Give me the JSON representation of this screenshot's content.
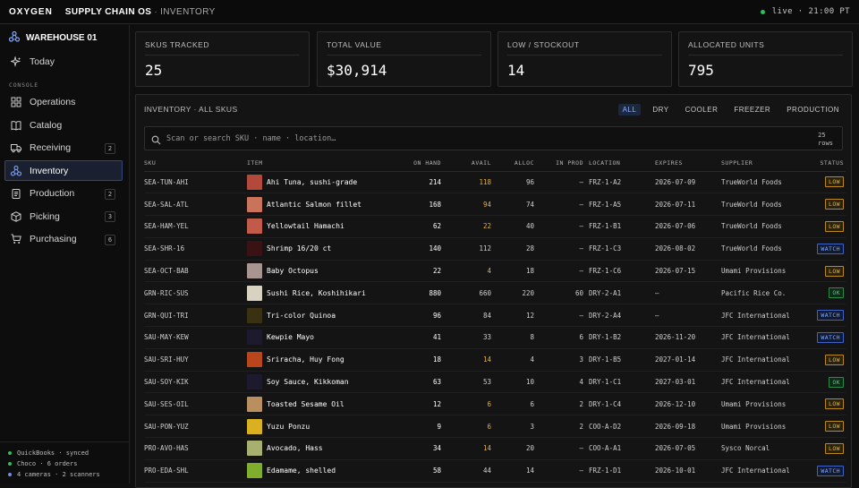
{
  "topbar": {
    "brand": "OXYGEN",
    "app": "SUPPLY CHAIN OS",
    "separator": "·",
    "section": "INVENTORY",
    "live_text": "live · 21:00 PT"
  },
  "sidebar": {
    "warehouse": "WAREHOUSE 01",
    "today_label": "Today",
    "section_label": "CONSOLE",
    "items": [
      {
        "label": "Operations",
        "icon": "operations-icon",
        "badge": ""
      },
      {
        "label": "Catalog",
        "icon": "book-icon",
        "badge": ""
      },
      {
        "label": "Receiving",
        "icon": "truck-icon",
        "badge": "2"
      },
      {
        "label": "Inventory",
        "icon": "network-icon",
        "badge": "",
        "active": true
      },
      {
        "label": "Production",
        "icon": "clipboard-icon",
        "badge": "2"
      },
      {
        "label": "Picking",
        "icon": "box-icon",
        "badge": "3"
      },
      {
        "label": "Purchasing",
        "icon": "cart-icon",
        "badge": "6"
      }
    ],
    "sync": [
      {
        "text": "QuickBooks · synced",
        "color": "#2fbf58"
      },
      {
        "text": "Choco · 6 orders",
        "color": "#2fbf58"
      },
      {
        "text": "4 cameras · 2 scanners",
        "color": "#6f8fe6"
      }
    ]
  },
  "kpis": [
    {
      "label": "SKUS TRACKED",
      "value": "25"
    },
    {
      "label": "TOTAL VALUE",
      "value": "$30,914"
    },
    {
      "label": "LOW / STOCKOUT",
      "value": "14"
    },
    {
      "label": "ALLOCATED UNITS",
      "value": "795"
    }
  ],
  "inventory": {
    "title": "INVENTORY · ALL SKUS",
    "filters": [
      "ALL",
      "DRY",
      "COOLER",
      "FREEZER",
      "PRODUCTION"
    ],
    "active_filter": "ALL",
    "search_placeholder": "Scan or search SKU · name · location…",
    "rows_count": "25",
    "rows_label": "rows",
    "columns": [
      "SKU",
      "ITEM",
      "ON HAND",
      "AVAIL",
      "ALLOC",
      "IN PROD",
      "LOCATION",
      "EXPIRES",
      "SUPPLIER",
      "STATUS"
    ],
    "rows": [
      {
        "sku": "SEA-TUN-AHI",
        "item": "Ahi Tuna, sushi-grade",
        "on_hand": "214",
        "avail": "118",
        "alloc": "96",
        "in_prod": "—",
        "location": "FRZ-1-A2",
        "expires": "2026-07-09",
        "supplier": "TrueWorld Foods",
        "status": "LOW",
        "thumb": "#b2493a"
      },
      {
        "sku": "SEA-SAL-ATL",
        "item": "Atlantic Salmon fillet",
        "on_hand": "168",
        "avail": "94",
        "alloc": "74",
        "in_prod": "—",
        "location": "FRZ-1-A5",
        "expires": "2026-07-11",
        "supplier": "TrueWorld Foods",
        "status": "LOW",
        "thumb": "#c9745a"
      },
      {
        "sku": "SEA-HAM-YEL",
        "item": "Yellowtail Hamachi",
        "on_hand": "62",
        "avail": "22",
        "alloc": "40",
        "in_prod": "—",
        "location": "FRZ-1-B1",
        "expires": "2026-07-06",
        "supplier": "TrueWorld Foods",
        "status": "LOW",
        "thumb": "#c25a4a"
      },
      {
        "sku": "SEA-SHR-16",
        "item": "Shrimp 16/20 ct",
        "on_hand": "140",
        "avail": "112",
        "alloc": "28",
        "in_prod": "—",
        "location": "FRZ-1-C3",
        "expires": "2026-08-02",
        "supplier": "TrueWorld Foods",
        "status": "WATCH",
        "thumb": "#3a1214"
      },
      {
        "sku": "SEA-OCT-BAB",
        "item": "Baby Octopus",
        "on_hand": "22",
        "avail": "4",
        "alloc": "18",
        "in_prod": "—",
        "location": "FRZ-1-C6",
        "expires": "2026-07-15",
        "supplier": "Umami Provisions",
        "status": "LOW",
        "thumb": "#a89590"
      },
      {
        "sku": "GRN-RIC-SUS",
        "item": "Sushi Rice, Koshihikari",
        "on_hand": "880",
        "avail": "660",
        "alloc": "220",
        "in_prod": "60",
        "location": "DRY-2-A1",
        "expires": "—",
        "supplier": "Pacific Rice Co.",
        "status": "OK",
        "thumb": "#d8d2c0"
      },
      {
        "sku": "GRN-QUI-TRI",
        "item": "Tri-color Quinoa",
        "on_hand": "96",
        "avail": "84",
        "alloc": "12",
        "in_prod": "—",
        "location": "DRY-2-A4",
        "expires": "—",
        "supplier": "JFC International",
        "status": "WATCH",
        "thumb": "#3a3012"
      },
      {
        "sku": "SAU-MAY-KEW",
        "item": "Kewpie Mayo",
        "on_hand": "41",
        "avail": "33",
        "alloc": "8",
        "in_prod": "6",
        "location": "DRY-1-B2",
        "expires": "2026-11-20",
        "supplier": "JFC International",
        "status": "WATCH",
        "thumb": "#1e1a2e"
      },
      {
        "sku": "SAU-SRI-HUY",
        "item": "Sriracha, Huy Fong",
        "on_hand": "18",
        "avail": "14",
        "alloc": "4",
        "in_prod": "3",
        "location": "DRY-1-B5",
        "expires": "2027-01-14",
        "supplier": "JFC International",
        "status": "LOW",
        "thumb": "#b8451c"
      },
      {
        "sku": "SAU-SOY-KIK",
        "item": "Soy Sauce, Kikkoman",
        "on_hand": "63",
        "avail": "53",
        "alloc": "10",
        "in_prod": "4",
        "location": "DRY-1-C1",
        "expires": "2027-03-01",
        "supplier": "JFC International",
        "status": "OK",
        "thumb": "#1e1a2e"
      },
      {
        "sku": "SAU-SES-OIL",
        "item": "Toasted Sesame Oil",
        "on_hand": "12",
        "avail": "6",
        "alloc": "6",
        "in_prod": "2",
        "location": "DRY-1-C4",
        "expires": "2026-12-10",
        "supplier": "Umami Provisions",
        "status": "LOW",
        "thumb": "#b89060"
      },
      {
        "sku": "SAU-PON-YUZ",
        "item": "Yuzu Ponzu",
        "on_hand": "9",
        "avail": "6",
        "alloc": "3",
        "in_prod": "2",
        "location": "COO-A-D2",
        "expires": "2026-09-18",
        "supplier": "Umami Provisions",
        "status": "LOW",
        "thumb": "#d9b020"
      },
      {
        "sku": "PRO-AVO-HAS",
        "item": "Avocado, Hass",
        "on_hand": "34",
        "avail": "14",
        "alloc": "20",
        "in_prod": "—",
        "location": "COO-A-A1",
        "expires": "2026-07-05",
        "supplier": "Sysco Norcal",
        "status": "LOW",
        "thumb": "#a8b070"
      },
      {
        "sku": "PRO-EDA-SHL",
        "item": "Edamame, shelled",
        "on_hand": "58",
        "avail": "44",
        "alloc": "14",
        "in_prod": "—",
        "location": "FRZ-1-D1",
        "expires": "2026-10-01",
        "supplier": "JFC International",
        "status": "WATCH",
        "thumb": "#7fae2e"
      }
    ]
  },
  "colors": {
    "accent": "#8ab0ff",
    "low": "#e9b02c",
    "watch": "#7fa6ff",
    "ok": "#4ad07a",
    "live": "#2fbf58"
  }
}
